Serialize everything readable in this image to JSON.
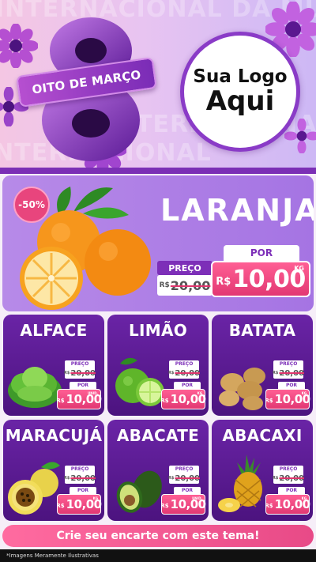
{
  "header": {
    "bg_words": [
      "INTERNACIONAL DA MU",
      "DIA INTERNACIONAL",
      "INTERNACIONAL"
    ],
    "ribbon_text": "OITO DE MARÇO",
    "logo_line1": "Sua Logo",
    "logo_line2": "Aqui"
  },
  "featured": {
    "title": "LARANJA",
    "discount": "-50%",
    "old_label": "PREÇO",
    "old_currency": "R$",
    "old_price": "20,00",
    "new_label": "POR",
    "new_currency": "R$",
    "new_price": "10,00",
    "unit": "KG"
  },
  "products": [
    {
      "name": "ALFACE",
      "old_label": "PREÇO",
      "old_currency": "R$",
      "old_price": "20,00",
      "new_label": "POR",
      "new_currency": "R$",
      "new_price": "10,00",
      "unit": "UNID."
    },
    {
      "name": "LIMÃO",
      "old_label": "PREÇO",
      "old_currency": "R$",
      "old_price": "20,00",
      "new_label": "POR",
      "new_currency": "R$",
      "new_price": "10,00",
      "unit": "KG"
    },
    {
      "name": "BATATA",
      "old_label": "PREÇO",
      "old_currency": "R$",
      "old_price": "20,00",
      "new_label": "POR",
      "new_currency": "R$",
      "new_price": "10,00",
      "unit": "KG"
    },
    {
      "name": "MARACUJÁ",
      "old_label": "PREÇO",
      "old_currency": "R$",
      "old_price": "20,00",
      "new_label": "POR",
      "new_currency": "R$",
      "new_price": "10,00",
      "unit": "KG"
    },
    {
      "name": "ABACATE",
      "old_label": "PREÇO",
      "old_currency": "R$",
      "old_price": "20,00",
      "new_label": "POR",
      "new_currency": "R$",
      "new_price": "10,00",
      "unit": "UNID."
    },
    {
      "name": "ABACAXI",
      "old_label": "PREÇO",
      "old_currency": "R$",
      "old_price": "20,00",
      "new_label": "POR",
      "new_currency": "R$",
      "new_price": "10,00",
      "unit": "KG"
    }
  ],
  "footer": {
    "cta": "Crie seu encarte com este tema!",
    "disclaimer": "*Imagens Meramente Ilustrativas"
  },
  "colors": {
    "primary_purple": "#6a24a6",
    "accent_pink": "#e84a87",
    "lilac": "#b78ae8"
  }
}
